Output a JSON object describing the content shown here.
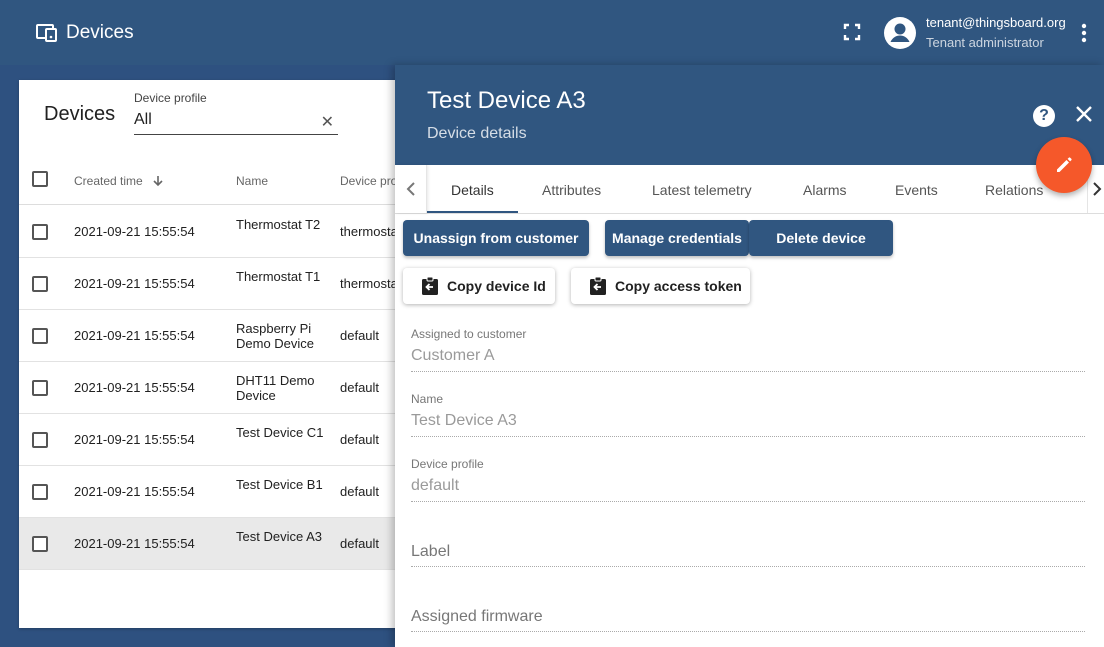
{
  "app": {
    "title": "Devices",
    "user_email": "tenant@thingsboard.org",
    "user_role": "Tenant administrator",
    "icons": [
      "devices-icon",
      "fullscreen-icon",
      "account-circle-icon",
      "more-vert-icon"
    ]
  },
  "list": {
    "title": "Devices",
    "filter": {
      "label": "Device profile",
      "value": "All"
    },
    "columns": {
      "created": "Created time",
      "name": "Name",
      "profile": "Device pro"
    },
    "rows": [
      {
        "created": "2021-09-21 15:55:54",
        "name": "Thermostat T2",
        "profile": "thermosta"
      },
      {
        "created": "2021-09-21 15:55:54",
        "name": "Thermostat T1",
        "profile": "thermosta"
      },
      {
        "created": "2021-09-21 15:55:54",
        "name": "Raspberry Pi Demo Device",
        "profile": "default"
      },
      {
        "created": "2021-09-21 15:55:54",
        "name": "DHT11 Demo Device",
        "profile": "default"
      },
      {
        "created": "2021-09-21 15:55:54",
        "name": "Test Device C1",
        "profile": "default"
      },
      {
        "created": "2021-09-21 15:55:54",
        "name": "Test Device B1",
        "profile": "default"
      },
      {
        "created": "2021-09-21 15:55:54",
        "name": "Test Device A3",
        "profile": "default"
      }
    ]
  },
  "detail": {
    "title": "Test Device A3",
    "subtitle": "Device details",
    "tabs": [
      "Details",
      "Attributes",
      "Latest telemetry",
      "Alarms",
      "Events",
      "Relations"
    ],
    "active_tab": "Details",
    "buttons": {
      "unassign": "Unassign from customer",
      "credentials": "Manage credentials",
      "delete": "Delete device",
      "copy_id": "Copy device Id",
      "copy_token": "Copy access token"
    },
    "fields": {
      "customer_label": "Assigned to customer",
      "customer_value": "Customer A",
      "name_label": "Name",
      "name_value": "Test Device A3",
      "profile_label": "Device profile",
      "profile_value": "default",
      "label_placeholder": "Label",
      "firmware_placeholder": "Assigned firmware"
    }
  },
  "colors": {
    "primary": "#305680",
    "accent": "#f5582a",
    "selected_row": "#e9e9e9"
  }
}
